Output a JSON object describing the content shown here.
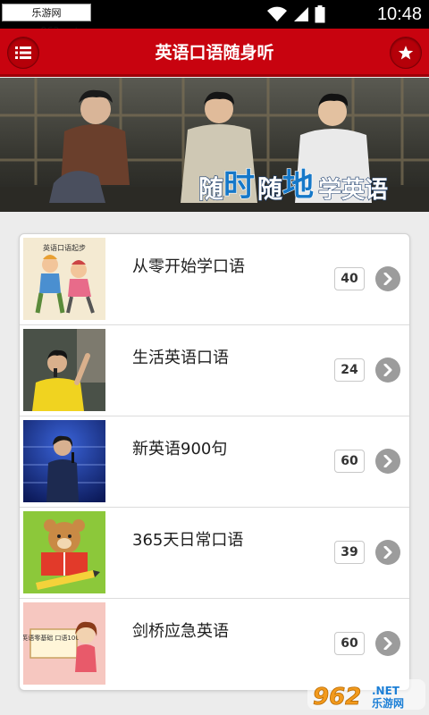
{
  "status_bar": {
    "watermark": "乐游网 www.962.net",
    "time": "10:48"
  },
  "app_bar": {
    "title": "英语口语随身听"
  },
  "banner": {
    "slogan": [
      "随",
      "时",
      "随",
      "地",
      "学英语"
    ]
  },
  "lessons": [
    {
      "title": "从零开始学口语",
      "count": "40",
      "thumb_caption": "英语口语起步"
    },
    {
      "title": "生活英语口语",
      "count": "24"
    },
    {
      "title": "新英语900句",
      "count": "60"
    },
    {
      "title": "365天日常口语",
      "count": "39"
    },
    {
      "title": "剑桥应急英语",
      "count": "60",
      "thumb_caption": "英语零基础 口语100句"
    }
  ],
  "corner_watermark": {
    "number": "962",
    "suffix": ".NET",
    "label": "乐游网"
  },
  "colors": {
    "app_bar": "#c8030f",
    "chevron_button": "#9c9c9c",
    "banner_slogan": "#ffffff",
    "banner_slogan_accent": "#1678c8"
  },
  "icons": {
    "menu": "list-icon",
    "favorite": "star-icon",
    "row_action": "chevron-right-icon"
  }
}
